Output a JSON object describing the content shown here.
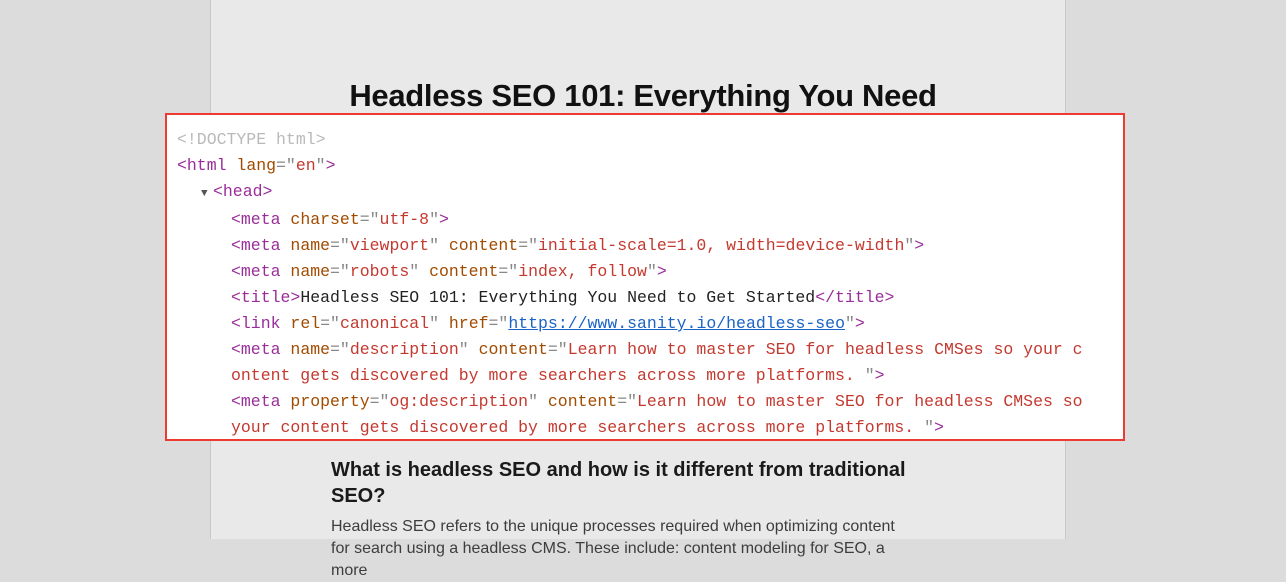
{
  "page": {
    "title": "Headless SEO 101: Everything You Need",
    "subheading": "What is headless SEO and how is it different from traditional SEO?",
    "paragraph": "Headless SEO refers to the unique processes required when optimizing content for search  using a headless CMS. These include: content modeling for SEO, a more"
  },
  "code": {
    "doctype": "<!DOCTYPE html>",
    "html_open_tag": "html",
    "html_lang_attr": "lang",
    "html_lang_val": "en",
    "head_tag": "head",
    "meta_tag": "meta",
    "link_tag": "link",
    "title_tag": "title",
    "charset_attr": "charset",
    "charset_val": "utf-8",
    "name_attr": "name",
    "content_attr": "content",
    "property_attr": "property",
    "rel_attr": "rel",
    "href_attr": "href",
    "viewport_name": "viewport",
    "viewport_content": "initial-scale=1.0, width=device-width",
    "robots_name": "robots",
    "robots_content": "index, follow",
    "title_text": "Headless SEO 101: Everything You Need to Get Started",
    "canonical_rel": "canonical",
    "canonical_href": "https://www.sanity.io/headless-seo",
    "desc_name": "description",
    "desc_content_a": "Learn how to master SEO for headless CMSes so your c",
    "desc_content_b": "ontent gets discovered by more searchers across more platforms. ",
    "og_prop": "og:description",
    "og_content_a": "Learn how to master SEO for headless CMSes so ",
    "og_content_b": "your content gets discovered by more searchers across more platforms. "
  }
}
